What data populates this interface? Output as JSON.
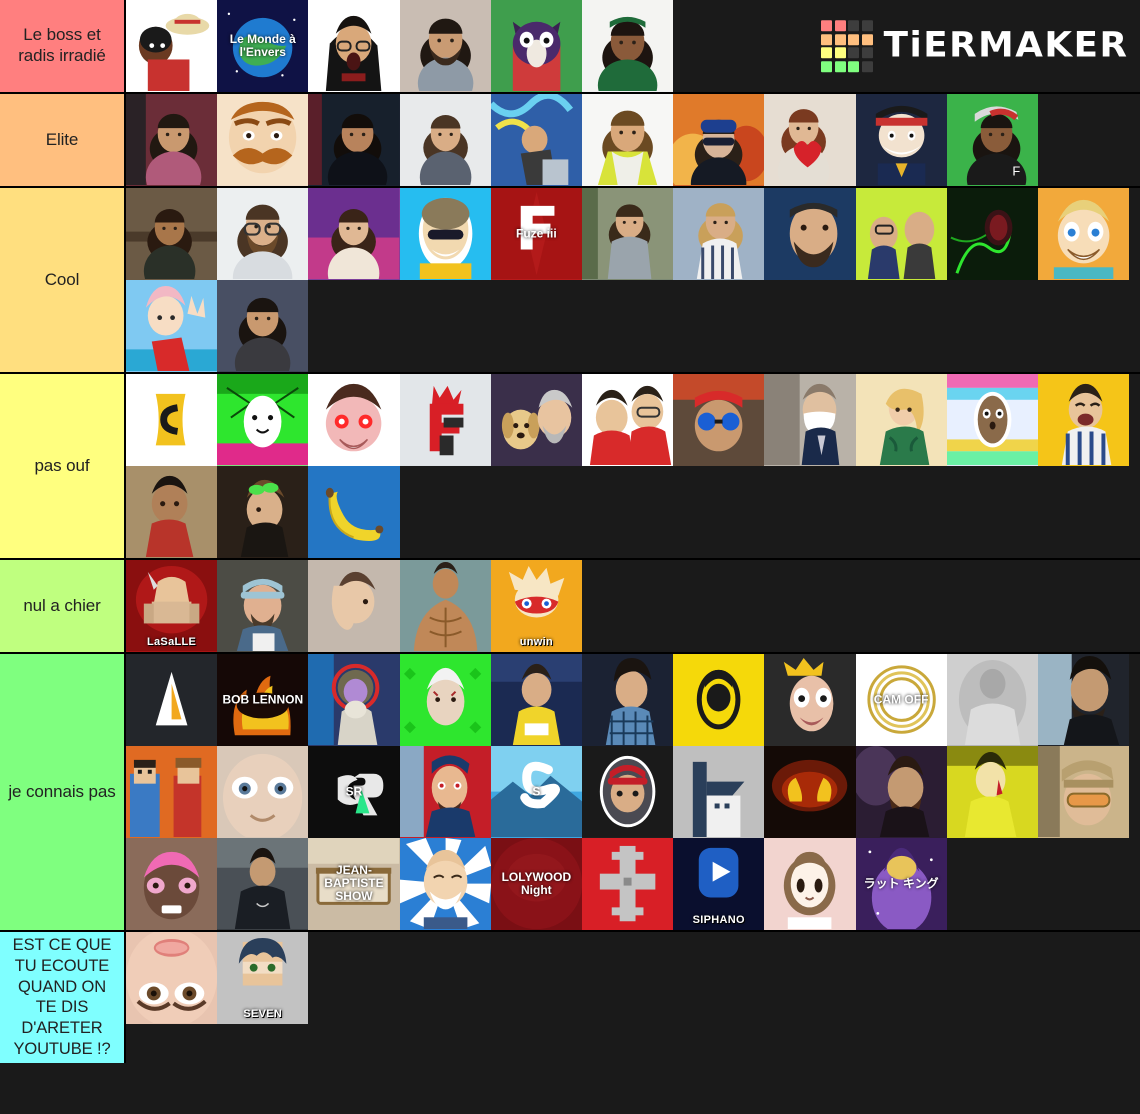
{
  "app": {
    "name": "TierMaker",
    "logo_text": "TiERMAKER",
    "logo_colors": [
      "#ff7f7f",
      "#ff7f7f",
      "#3d3d3d",
      "#3d3d3d",
      "#ffbf7f",
      "#ffbf7f",
      "#ffbf7f",
      "#ffbf7f",
      "#ffff7f",
      "#ffff7f",
      "#3d3d3d",
      "#3d3d3d",
      "#7fff7f",
      "#7fff7f",
      "#7fff7f",
      "#3d3d3d"
    ],
    "background": "#1a1a1a"
  },
  "tiers": [
    {
      "label": "Le boss et radis irradié",
      "color": "#ff7f7f",
      "rows": 1,
      "items": [
        {
          "name": "avatar-cartoon-luffy-hat",
          "caption": "",
          "bg": "#ffffff",
          "art": "luffy"
        },
        {
          "name": "avatar-le-monde-a-l-envers",
          "caption": "Le Monde à l'Envers",
          "bg": "#0f1245",
          "art": "monde"
        },
        {
          "name": "avatar-shocked-person-hands-head",
          "caption": "",
          "bg": "#ffffff",
          "art": "shock"
        },
        {
          "name": "avatar-bearded-man-grey-shirt",
          "caption": "",
          "bg": "#c9bdb3",
          "art": "beard1"
        },
        {
          "name": "avatar-purple-cat-character",
          "caption": "",
          "bg": "#3f9e4d",
          "art": "cat"
        },
        {
          "name": "avatar-man-green-shirt-headband",
          "caption": "",
          "bg": "#f2f2f2",
          "art": "green"
        }
      ]
    },
    {
      "label": "Elite",
      "color": "#ffbf7f",
      "rows": 1,
      "items": [
        {
          "name": "avatar-man-red-studio",
          "caption": "",
          "bg": "#6b2d38",
          "art": "red1"
        },
        {
          "name": "avatar-cartoon-moustache",
          "caption": "",
          "bg": "#f2ddc7",
          "art": "mous"
        },
        {
          "name": "avatar-man-dark-stage",
          "caption": "",
          "bg": "#1b2230",
          "art": "dark1"
        },
        {
          "name": "avatar-man-grey-background",
          "caption": "",
          "bg": "#e7e9ea",
          "art": "grey1"
        },
        {
          "name": "avatar-graffiti-wall",
          "caption": "",
          "bg": "#2f5fa8",
          "art": "graff"
        },
        {
          "name": "avatar-man-yellow-shirt",
          "caption": "",
          "bg": "#f7f7f5",
          "art": "yellow1"
        },
        {
          "name": "avatar-man-cap-sunglasses-fire",
          "caption": "",
          "bg": "#d0622a",
          "art": "fire1"
        },
        {
          "name": "avatar-man-red-heart",
          "caption": "",
          "bg": "#e6ddd2",
          "art": "heart"
        },
        {
          "name": "avatar-cartoon-monkey-cap",
          "caption": "",
          "bg": "#1d2740",
          "art": "monkey"
        },
        {
          "name": "avatar-man-red-cap-green",
          "caption": "",
          "bg": "#3bb34a",
          "art": "cap1"
        }
      ]
    },
    {
      "label": "Cool",
      "color": "#ffdf7f",
      "rows": 2,
      "items": [
        {
          "name": "avatar-curly-hair-glasses",
          "caption": "",
          "bg": "#6b5a45",
          "art": "curly"
        },
        {
          "name": "avatar-bearded-man-glasses",
          "caption": "",
          "bg": "#eceff0",
          "art": "beard2"
        },
        {
          "name": "avatar-young-man-purple-gradient",
          "caption": "",
          "bg": "#7d3f9a",
          "art": "purple1"
        },
        {
          "name": "avatar-fur-hat-sunglasses",
          "caption": "",
          "bg": "#26bdf0",
          "art": "fur"
        },
        {
          "name": "avatar-fuze-iii-logo",
          "caption": "Fuze iii",
          "bg": "#b71b1b",
          "art": "fuze"
        },
        {
          "name": "avatar-man-outdoors-grey-hoodie",
          "caption": "",
          "bg": "#7d8a74",
          "art": "hoodie"
        },
        {
          "name": "avatar-man-striped-shirt",
          "caption": "",
          "bg": "#9fb2c6",
          "art": "stripe"
        },
        {
          "name": "avatar-man-beanie-beard",
          "caption": "",
          "bg": "#1c3a63",
          "art": "beanie"
        },
        {
          "name": "avatar-two-men-yellow-screen",
          "caption": "",
          "bg": "#c7ea3a",
          "art": "two1"
        },
        {
          "name": "avatar-green-neon-dark",
          "caption": "",
          "bg": "#0b1c0b",
          "art": "neon"
        },
        {
          "name": "avatar-cartoon-blond-boy",
          "caption": "",
          "bg": "#f2a93b",
          "art": "blond"
        },
        {
          "name": "avatar-anime-pink-hair-peace",
          "caption": "",
          "bg": "#7fc9f2",
          "art": "anime1"
        },
        {
          "name": "avatar-man-dark-blue-bg",
          "caption": "",
          "bg": "#3f4457",
          "art": "blue1"
        }
      ]
    },
    {
      "label": "pas ouf",
      "color": "#ffff7f",
      "rows": 2,
      "items": [
        {
          "name": "avatar-yellow-ticket-logo",
          "caption": "",
          "bg": "#ffffff",
          "art": "ticket"
        },
        {
          "name": "avatar-white-alien-rainbow",
          "caption": "",
          "bg": "#7fe07f",
          "art": "alien"
        },
        {
          "name": "avatar-glowing-red-eyes-face",
          "caption": "",
          "bg": "#ffffff",
          "art": "redeye"
        },
        {
          "name": "avatar-red-f-logo",
          "caption": "",
          "bg": "#dfe3e6",
          "art": "flogo"
        },
        {
          "name": "avatar-man-with-dog",
          "caption": "",
          "bg": "#3a2f4a",
          "art": "dog"
        },
        {
          "name": "avatar-two-friends-red-shirt",
          "caption": "",
          "bg": "#ffffff",
          "art": "two2"
        },
        {
          "name": "avatar-blue-sunglasses-headband",
          "caption": "",
          "bg": "#5e4a3a",
          "art": "bluesun"
        },
        {
          "name": "avatar-man-face-mask",
          "caption": "",
          "bg": "#b9b2a8",
          "art": "mask"
        },
        {
          "name": "avatar-woman-green-dress",
          "caption": "",
          "bg": "#f3e3b8",
          "art": "woman1"
        },
        {
          "name": "avatar-potato-character-rainbow",
          "caption": "",
          "bg": "#e0e8f7",
          "art": "potato"
        },
        {
          "name": "avatar-laughing-man-stripes",
          "caption": "",
          "bg": "#f5c518",
          "art": "laugh"
        },
        {
          "name": "avatar-child-photo",
          "caption": "",
          "bg": "#a8906a",
          "art": "child"
        },
        {
          "name": "avatar-man-goggles-head",
          "caption": "",
          "bg": "#2a2018",
          "art": "goggles"
        },
        {
          "name": "avatar-banana-emoji",
          "caption": "",
          "bg": "#2476c4",
          "art": "banana"
        }
      ]
    },
    {
      "label": "nul a chier",
      "color": "#bfff7f",
      "rows": 1,
      "items": [
        {
          "name": "avatar-lasalle-logo",
          "caption": "LaSaLLE",
          "bg": "#a81414",
          "art": "lasalle"
        },
        {
          "name": "avatar-man-light-cap",
          "caption": "",
          "bg": "#4c4c45",
          "art": "lightcap"
        },
        {
          "name": "avatar-man-hand-on-face",
          "caption": "",
          "bg": "#c4b8ad",
          "art": "facepalm"
        },
        {
          "name": "avatar-muscular-man",
          "caption": "",
          "bg": "#7b9a9a",
          "art": "muscle"
        },
        {
          "name": "avatar-unwin-logo",
          "caption": "unwin",
          "bg": "#f2a81e",
          "art": "unwin"
        }
      ]
    },
    {
      "label": "je connais pas",
      "color": "#7fff7f",
      "rows": 3,
      "items": [
        {
          "name": "avatar-white-orange-a-logo",
          "caption": "",
          "bg": "#23262b",
          "art": "alogo"
        },
        {
          "name": "avatar-bob-lennon-logo",
          "caption": "BOB LENNON",
          "bg": "#120806",
          "art": "boblennon"
        },
        {
          "name": "avatar-stained-glass-character",
          "caption": "",
          "bg": "#2a3a6b",
          "art": "glass"
        },
        {
          "name": "avatar-face-green-pattern",
          "caption": "",
          "bg": "#2ee62e",
          "art": "greenpat"
        },
        {
          "name": "avatar-man-yellow-hoodie",
          "caption": "",
          "bg": "#1b2a52",
          "art": "yhood"
        },
        {
          "name": "avatar-man-checkered-shirt",
          "caption": "",
          "bg": "#1b2233",
          "art": "check"
        },
        {
          "name": "avatar-black-silhouette-yellow",
          "caption": "",
          "bg": "#f5d90a",
          "art": "silh"
        },
        {
          "name": "avatar-drawn-face-crown",
          "caption": "",
          "bg": "#2a2a2a",
          "art": "crown"
        },
        {
          "name": "avatar-cam-off-gold-logo",
          "caption": "CAM OFF",
          "bg": "#ffffff",
          "art": "camoff"
        },
        {
          "name": "avatar-black-white-man",
          "caption": "",
          "bg": "#b5b5b5",
          "art": "bw"
        },
        {
          "name": "avatar-man-dark-hair-profile",
          "caption": "",
          "bg": "#20242c",
          "art": "profile"
        },
        {
          "name": "avatar-minecraft-characters",
          "caption": "",
          "bg": "#e06a22",
          "art": "mc"
        },
        {
          "name": "avatar-wide-eyes-closeup",
          "caption": "",
          "bg": "#d9c8b8",
          "art": "eyes"
        },
        {
          "name": "avatar-sr-logo",
          "caption": "SR",
          "bg": "#0d0d0d",
          "art": "srlogo"
        },
        {
          "name": "avatar-drawn-man-red-blue",
          "caption": "",
          "bg": "#c41e28",
          "art": "drawn1"
        },
        {
          "name": "avatar-blue-s-logo",
          "caption": "S",
          "bg": "#3fa7e0",
          "art": "slogo"
        },
        {
          "name": "avatar-man-red-cap-circle",
          "caption": "",
          "bg": "#1e1e1e",
          "art": "redcapc"
        },
        {
          "name": "avatar-navy-house-icon",
          "caption": "",
          "bg": "#bfbfbf",
          "art": "house"
        },
        {
          "name": "avatar-fire-eyes-dark",
          "caption": "",
          "bg": "#140a06",
          "art": "fireeyes"
        },
        {
          "name": "avatar-bearded-man-purple",
          "caption": "",
          "bg": "#2b1d33",
          "art": "beardpur"
        },
        {
          "name": "avatar-yellow-jacket-man",
          "caption": "",
          "bg": "#d8d820",
          "art": "yjack"
        },
        {
          "name": "avatar-man-pattern-cap",
          "caption": "",
          "bg": "#cbb48a",
          "art": "patcap"
        },
        {
          "name": "avatar-pink-mask-character",
          "caption": "",
          "bg": "#8a6b5a",
          "art": "pinkmask"
        },
        {
          "name": "avatar-man-black-hoodie-outside",
          "caption": "",
          "bg": "#3a3f44",
          "art": "bhood"
        },
        {
          "name": "avatar-jean-baptiste-show-logo",
          "caption": "JEAN-BAPTISTE SHOW",
          "bg": "#cbbba4",
          "art": "jbshow"
        },
        {
          "name": "avatar-cartoon-man-blue-rays",
          "caption": "",
          "bg": "#2b7fd4",
          "art": "rays"
        },
        {
          "name": "avatar-lolywood-night-logo",
          "caption": "LOLYWOOD Night",
          "bg": "#7a0f14",
          "art": "loly"
        },
        {
          "name": "avatar-grey-cross-red",
          "caption": "",
          "bg": "#d81f26",
          "art": "cross"
        },
        {
          "name": "avatar-siphano-logo",
          "caption": "SIPHANO",
          "bg": "#0a0f2e",
          "art": "siphano"
        },
        {
          "name": "avatar-anime-girl-brown-hair",
          "caption": "",
          "bg": "#f2d4cf",
          "art": "animegirl"
        },
        {
          "name": "avatar-purple-japanese-text",
          "caption": "ラット キング",
          "bg": "#3a1f5c",
          "art": "jp"
        }
      ]
    },
    {
      "label": "EST CE QUE TU ECOUTE QUAND ON TE DIS D'ARETER YOUTUBE !?",
      "color": "#7fffff",
      "rows": 1,
      "items": [
        {
          "name": "avatar-closeup-eyes-face",
          "caption": "",
          "bg": "#e8c4b0",
          "art": "closeeyes"
        },
        {
          "name": "avatar-docseven-logo",
          "caption": "SEVEN",
          "bg": "#c2c2c2",
          "art": "docseven"
        }
      ]
    }
  ]
}
